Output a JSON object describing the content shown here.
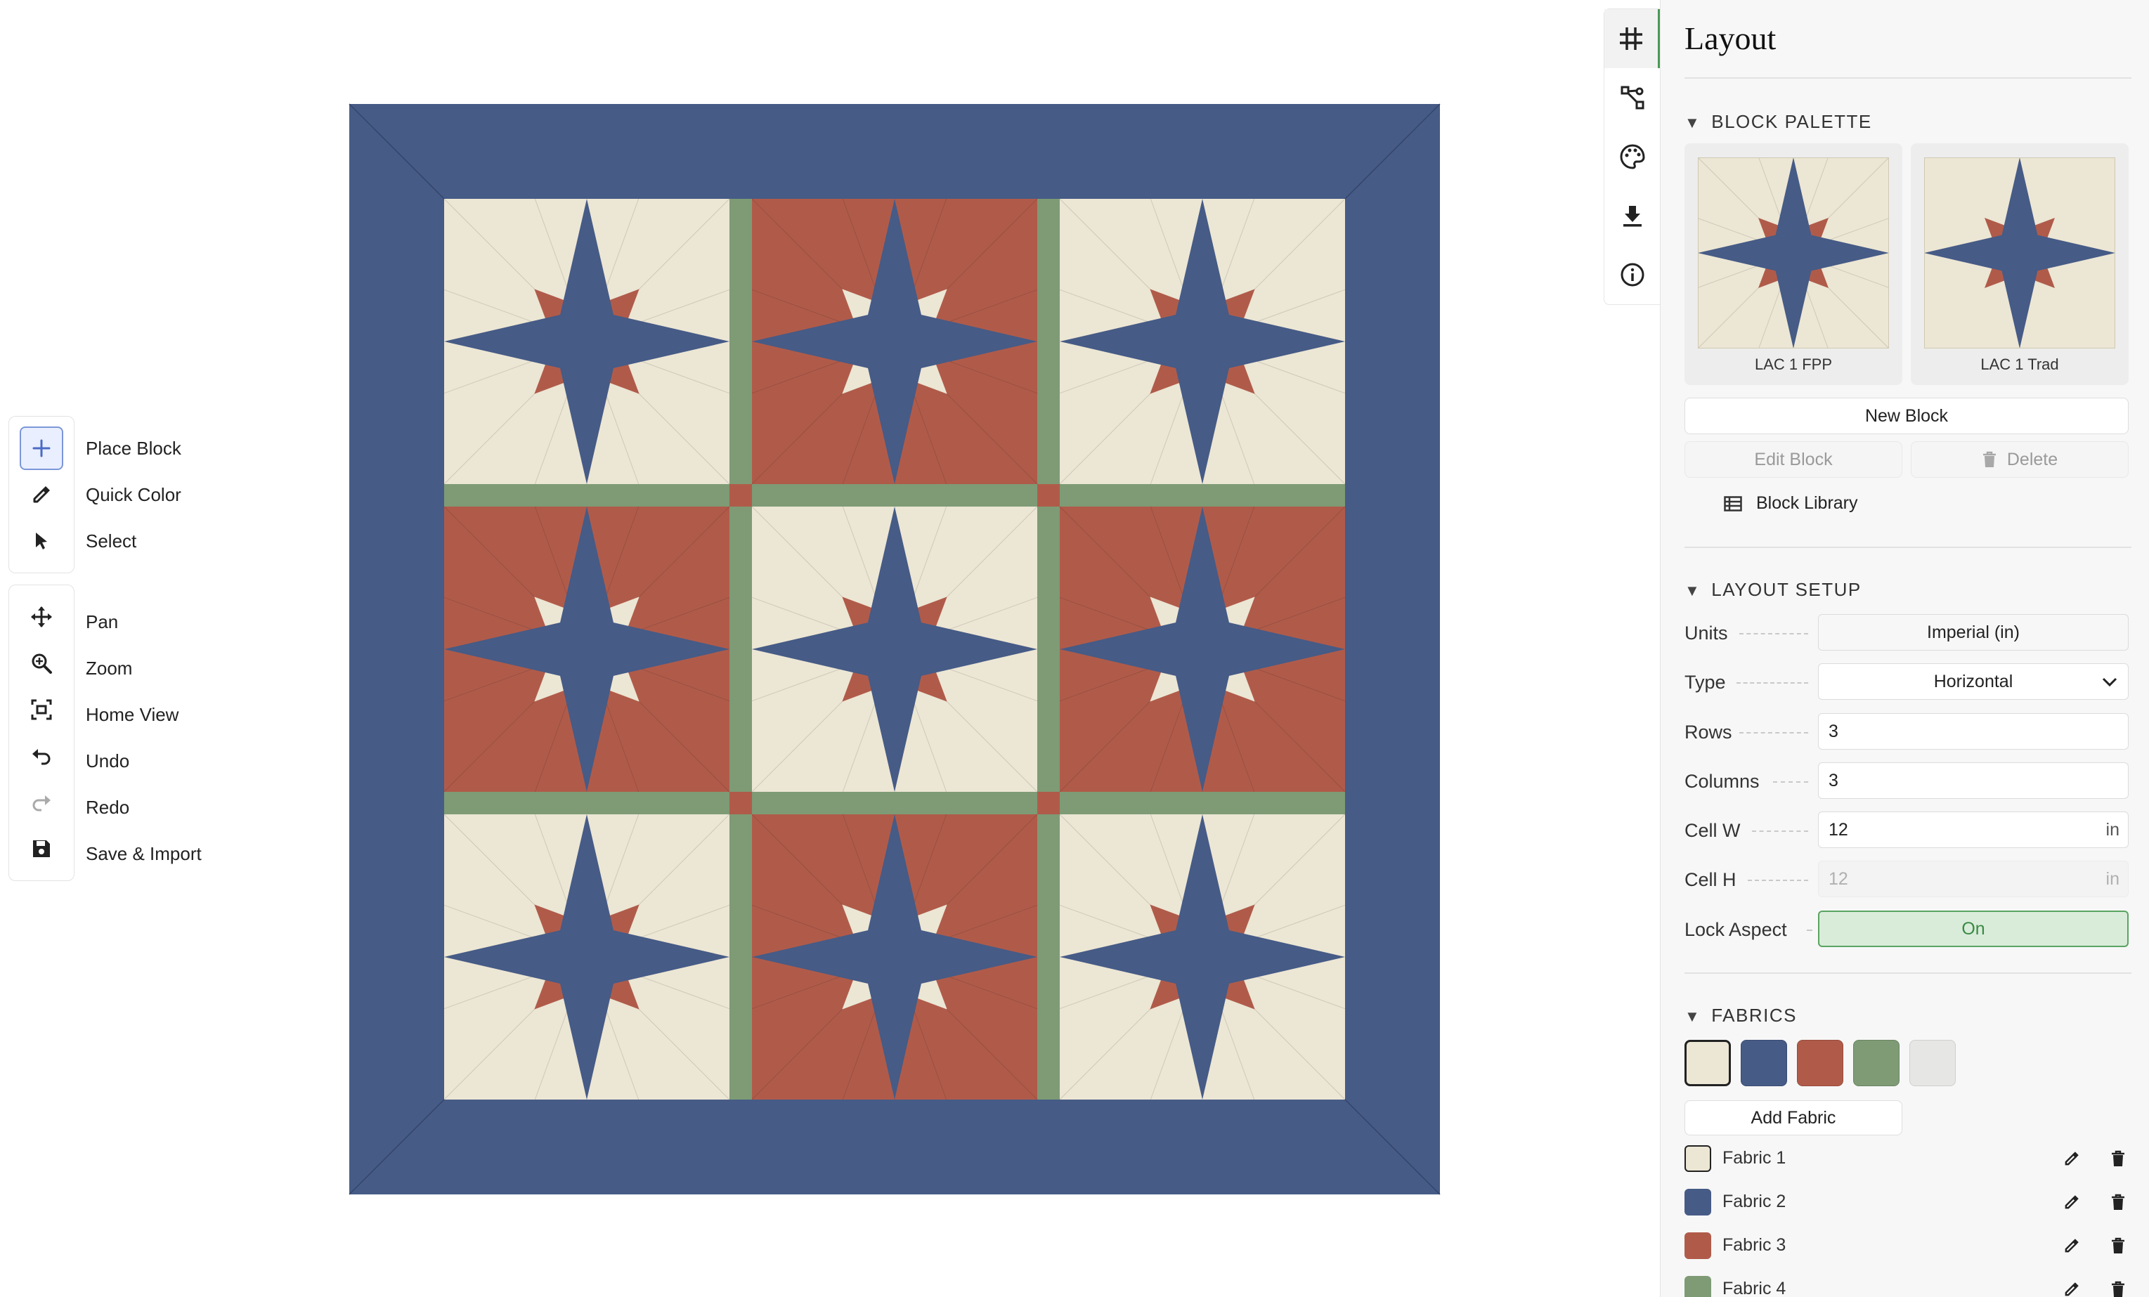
{
  "colors": {
    "cream": "#ece6d4",
    "navy": "#465b86",
    "rust": "#b05b4a",
    "green": "#7e9b75",
    "light_gray": "#e6e6e4",
    "accent_green": "#4a9a56",
    "lock_on_bg": "#d9ecda",
    "lock_on_text": "#3a8a43"
  },
  "quilt": {
    "rows": 3,
    "columns": 3,
    "block_pattern": [
      [
        "A",
        "B",
        "A"
      ],
      [
        "B",
        "A",
        "B"
      ],
      [
        "A",
        "B",
        "A"
      ]
    ],
    "block_variants": {
      "A": {
        "background": "cream",
        "star_points": "navy",
        "star_wedges": "rust"
      },
      "B": {
        "background": "rust",
        "star_points": "navy",
        "star_wedges": "cream"
      }
    },
    "sashing_color": "green",
    "cornerstone_color": "rust",
    "border_color": "navy"
  },
  "tools": {
    "group1": [
      {
        "label": "Place Block",
        "icon": "plus-icon",
        "active": true
      },
      {
        "label": "Quick Color",
        "icon": "eyedropper-icon",
        "active": false
      },
      {
        "label": "Select",
        "icon": "cursor-icon",
        "active": false
      }
    ],
    "group2": [
      {
        "label": "Pan",
        "icon": "move-icon"
      },
      {
        "label": "Zoom",
        "icon": "zoom-icon"
      },
      {
        "label": "Home View",
        "icon": "home-view-icon"
      },
      {
        "label": "Undo",
        "icon": "undo-icon"
      },
      {
        "label": "Redo",
        "icon": "redo-icon"
      },
      {
        "label": "Save & Import",
        "icon": "save-icon"
      }
    ]
  },
  "rail": [
    "grid-icon",
    "share-icon",
    "palette-icon",
    "download-icon",
    "info-icon"
  ],
  "sidebar": {
    "title": "Layout",
    "block_palette": {
      "title": "BLOCK PALETTE",
      "blocks": [
        {
          "label": "LAC 1 FPP"
        },
        {
          "label": "LAC 1 Trad"
        }
      ],
      "new_block": "New Block",
      "edit_block": "Edit Block",
      "delete": "Delete",
      "block_library": "Block Library"
    },
    "layout_setup": {
      "title": "LAYOUT SETUP",
      "units_label": "Units",
      "units_value": "Imperial (in)",
      "type_label": "Type",
      "type_value": "Horizontal",
      "rows_label": "Rows",
      "rows_value": "3",
      "columns_label": "Columns",
      "columns_value": "3",
      "cellw_label": "Cell W",
      "cellw_value": "12",
      "cellw_unit": "in",
      "cellh_label": "Cell H",
      "cellh_value": "12",
      "cellh_unit": "in",
      "lock_label": "Lock Aspect",
      "lock_value": "On"
    },
    "fabrics": {
      "title": "FABRICS",
      "swatches": [
        "cream",
        "navy",
        "rust",
        "green",
        "light_gray"
      ],
      "add_fabric": "Add Fabric",
      "list": [
        {
          "name": "Fabric 1",
          "color": "cream"
        },
        {
          "name": "Fabric 2",
          "color": "navy"
        },
        {
          "name": "Fabric 3",
          "color": "rust"
        },
        {
          "name": "Fabric 4",
          "color": "green"
        }
      ]
    }
  }
}
